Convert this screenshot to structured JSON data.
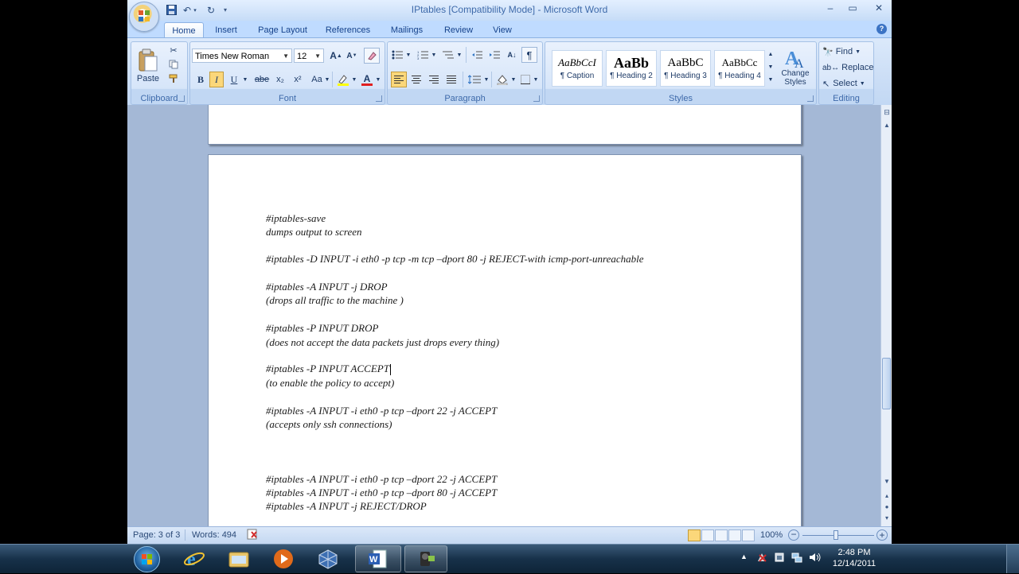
{
  "window": {
    "title": "IPtables [Compatibility Mode] - Microsoft Word",
    "minimize": "–",
    "maximize": "▭",
    "close": "✕"
  },
  "tabs": [
    "Home",
    "Insert",
    "Page Layout",
    "References",
    "Mailings",
    "Review",
    "View"
  ],
  "ribbon": {
    "clipboard": {
      "label": "Clipboard",
      "paste": "Paste"
    },
    "font": {
      "label": "Font",
      "family": "Times New Roman",
      "size": "12",
      "bold": "B",
      "italic": "I",
      "underline": "U",
      "strike": "abe",
      "subscript": "x₂",
      "superscript": "x²",
      "case": "Aa"
    },
    "paragraph": {
      "label": "Paragraph",
      "pilcrow": "¶"
    },
    "styles": {
      "label": "Styles",
      "items": [
        {
          "sample": "AaBbCcI",
          "name": "¶ Caption"
        },
        {
          "sample": "AaBb",
          "name": "¶ Heading 2"
        },
        {
          "sample": "AaBbC",
          "name": "¶ Heading 3"
        },
        {
          "sample": "AaBbCc",
          "name": "¶ Heading 4"
        }
      ],
      "change_styles": "Change Styles"
    },
    "editing": {
      "label": "Editing",
      "find": "Find",
      "replace": "Replace",
      "select": "Select"
    }
  },
  "document": {
    "lines": [
      "#iptables-save",
      "dumps output to screen",
      "#iptables -D INPUT -i eth0 -p tcp -m tcp –dport 80 -j REJECT-with icmp-port-unreachable",
      "#iptables -A INPUT -j DROP",
      "(drops all traffic to the machine )",
      "#iptables -P INPUT DROP",
      "(does not accept the data packets just drops every thing)",
      "#iptables -P INPUT ACCEPT",
      "(to enable the policy to accept)",
      "#iptables -A INPUT -i eth0 -p tcp –dport 22 -j ACCEPT",
      "(accepts only ssh connections)",
      "#iptables -A INPUT -i eth0 -p tcp –dport 22 -j ACCEPT",
      "#iptables -A INPUT -i eth0 -p tcp –dport 80 -j ACCEPT",
      "#iptables -A INPUT -j REJECT/DROP"
    ]
  },
  "status": {
    "page": "Page: 3 of 3",
    "words": "Words: 494",
    "zoom": "100%"
  },
  "taskbar": {
    "time": "2:48 PM",
    "date": "12/14/2011"
  }
}
